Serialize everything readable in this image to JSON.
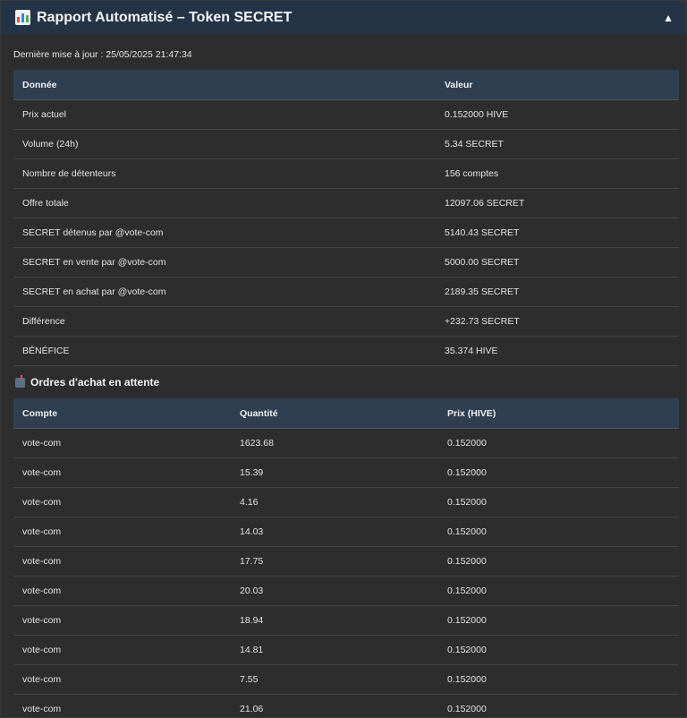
{
  "header": {
    "icon": "bar-chart-icon",
    "title": "Rapport Automatisé – Token SECRET",
    "toggle": "▲"
  },
  "updated": "Dernière mise à jour : 25/05/2025 21:47:34",
  "summary": {
    "columns": [
      "Donnée",
      "Valeur"
    ],
    "rows": [
      [
        "Prix actuel",
        "0.152000 HIVE"
      ],
      [
        "Volume (24h)",
        "5.34 SECRET"
      ],
      [
        "Nombre de détenteurs",
        "156 comptes"
      ],
      [
        "Offre totale",
        "12097.06 SECRET"
      ],
      [
        "SECRET détenus par @vote-com",
        "5140.43 SECRET"
      ],
      [
        "SECRET en vente par @vote-com",
        "5000.00 SECRET"
      ],
      [
        "SECRET en achat par @vote-com",
        "2189.35 SECRET"
      ],
      [
        "Différence",
        "+232.73 SECRET"
      ],
      [
        "BÉNÉFICE",
        "35.374 HIVE"
      ]
    ]
  },
  "orders": {
    "icon": "mailbox-icon",
    "title": "Ordres d'achat en attente",
    "columns": [
      "Compte",
      "Quantité",
      "Prix (HIVE)"
    ],
    "rows": [
      [
        "vote-com",
        "1623.68",
        "0.152000"
      ],
      [
        "vote-com",
        "15.39",
        "0.152000"
      ],
      [
        "vote-com",
        "4.16",
        "0.152000"
      ],
      [
        "vote-com",
        "14.03",
        "0.152000"
      ],
      [
        "vote-com",
        "17.75",
        "0.152000"
      ],
      [
        "vote-com",
        "20.03",
        "0.152000"
      ],
      [
        "vote-com",
        "18.94",
        "0.152000"
      ],
      [
        "vote-com",
        "14.81",
        "0.152000"
      ],
      [
        "vote-com",
        "7.55",
        "0.152000"
      ],
      [
        "vote-com",
        "21.06",
        "0.152000"
      ]
    ]
  }
}
